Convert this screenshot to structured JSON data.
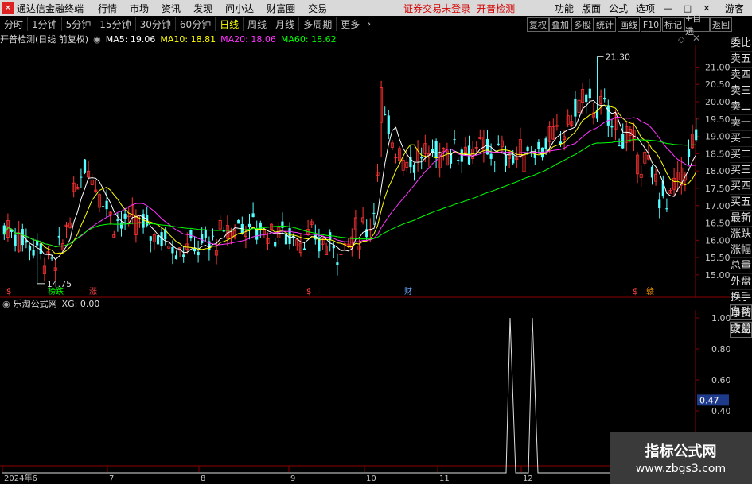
{
  "titlebar": {
    "app_title": "通达信金融终端",
    "menus": [
      "行情",
      "市场",
      "资讯",
      "发现",
      "问小达",
      "财富圈",
      "交易"
    ],
    "warning": "证券交易未登录",
    "stock_name": "开普检测",
    "right_items": [
      "功能",
      "版面",
      "公式",
      "选项"
    ],
    "user": "游客"
  },
  "periods": [
    "分时",
    "1分钟",
    "5分钟",
    "15分钟",
    "30分钟",
    "60分钟",
    "日线",
    "周线",
    "月线",
    "多周期",
    "更多"
  ],
  "active_period": "日线",
  "toolbar_right": [
    "复权",
    "叠加",
    "多股",
    "统计",
    "画线",
    "F10",
    "标记",
    "+自选",
    "返回"
  ],
  "main_info": {
    "title": "开普检测(日线 前复权)",
    "ma5": "MA5: 19.06",
    "ma10": "MA10: 18.81",
    "ma20": "MA20: 18.06",
    "ma60": "MA60: 18.62",
    "colors": {
      "ma5": "#ffffff",
      "ma10": "#ffff00",
      "ma20": "#ff33ff",
      "ma60": "#00ff00"
    }
  },
  "price_axis": [
    "21.00",
    "20.50",
    "20.00",
    "19.50",
    "19.00",
    "18.50",
    "18.00",
    "17.50",
    "17.00",
    "16.50",
    "16.00",
    "15.50",
    "15.00"
  ],
  "high_label": "21.30",
  "low_label": "14.75",
  "markers": [
    {
      "text": "$",
      "color": "#ff4444"
    },
    {
      "text": "榜跌",
      "color": "#00ff00"
    },
    {
      "text": "涨",
      "color": "#ff4444"
    },
    {
      "text": "$",
      "color": "#ff4444"
    },
    {
      "text": "财",
      "color": "#66aaff"
    },
    {
      "text": "$",
      "color": "#ff4444"
    },
    {
      "text": "赣",
      "color": "#ff9900"
    }
  ],
  "side_panel": [
    "委比",
    "卖五",
    "卖四",
    "卖三",
    "卖二",
    "卖一",
    "买一",
    "买二",
    "买三",
    "买四",
    "买五",
    "最新",
    "涨跌",
    "涨幅",
    "总量",
    "外盘",
    "换手",
    "净资",
    "收益"
  ],
  "side_panel2": [
    "自动",
    "交易"
  ],
  "sub_info": {
    "title": "乐淘公式网",
    "xg": "XG: 0.00"
  },
  "sub_axis": [
    "1.00",
    "0.80",
    "0.60",
    "0.40"
  ],
  "sub_current": "0.47",
  "date_axis": [
    "2024年6",
    "7",
    "8",
    "9",
    "10",
    "11",
    "12"
  ],
  "watermark": {
    "line1": "指标公式网",
    "line2": "www.zbgs3.com"
  },
  "chart_data": {
    "type": "candlestick",
    "price_range": [
      14.7,
      21.4
    ],
    "signal_series": {
      "name": "XG",
      "values": "0 except two spikes to 1.00 in December"
    }
  }
}
